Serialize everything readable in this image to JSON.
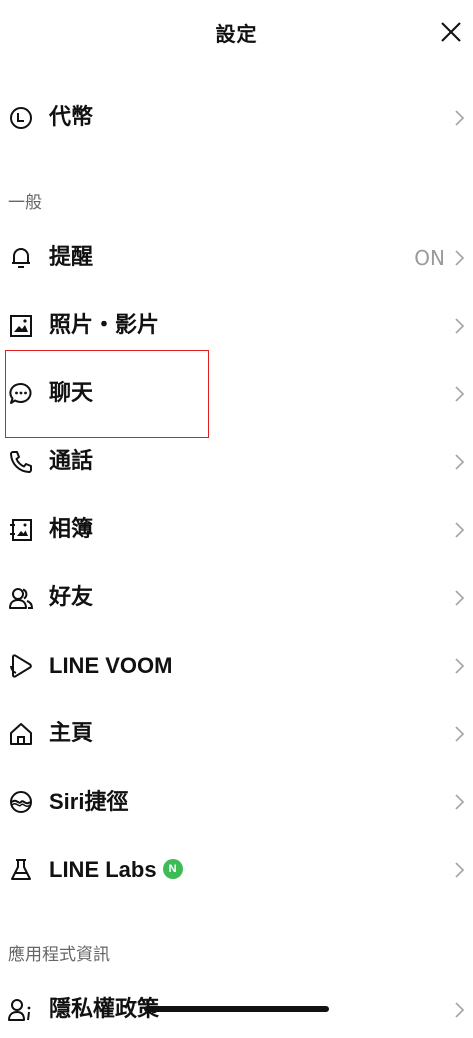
{
  "header": {
    "title": "設定"
  },
  "top_items": [
    {
      "label": "代幣",
      "icon": "clock-coin-icon"
    }
  ],
  "sections": [
    {
      "title": "一般",
      "items": [
        {
          "label": "提醒",
          "value": "ON",
          "icon": "bell-icon"
        },
        {
          "label": "照片・影片",
          "icon": "photo-icon"
        },
        {
          "label": "聊天",
          "icon": "chat-bubble-icon"
        },
        {
          "label": "通話",
          "icon": "phone-icon"
        },
        {
          "label": "相簿",
          "icon": "album-icon"
        },
        {
          "label": "好友",
          "icon": "friends-icon"
        },
        {
          "label": "LINE VOOM",
          "icon": "voom-icon"
        },
        {
          "label": "主頁",
          "icon": "home-icon"
        },
        {
          "label": "Siri捷徑",
          "icon": "siri-icon"
        },
        {
          "label": "LINE Labs",
          "badge": "N",
          "icon": "flask-icon"
        }
      ]
    },
    {
      "title": "應用程式資訊",
      "items": [
        {
          "label": "隱私權政策",
          "icon": "privacy-icon"
        }
      ]
    }
  ],
  "colors": {
    "highlight": "#e02020",
    "new_badge": "#3dbb57",
    "value_gray": "#9a9a9a"
  }
}
